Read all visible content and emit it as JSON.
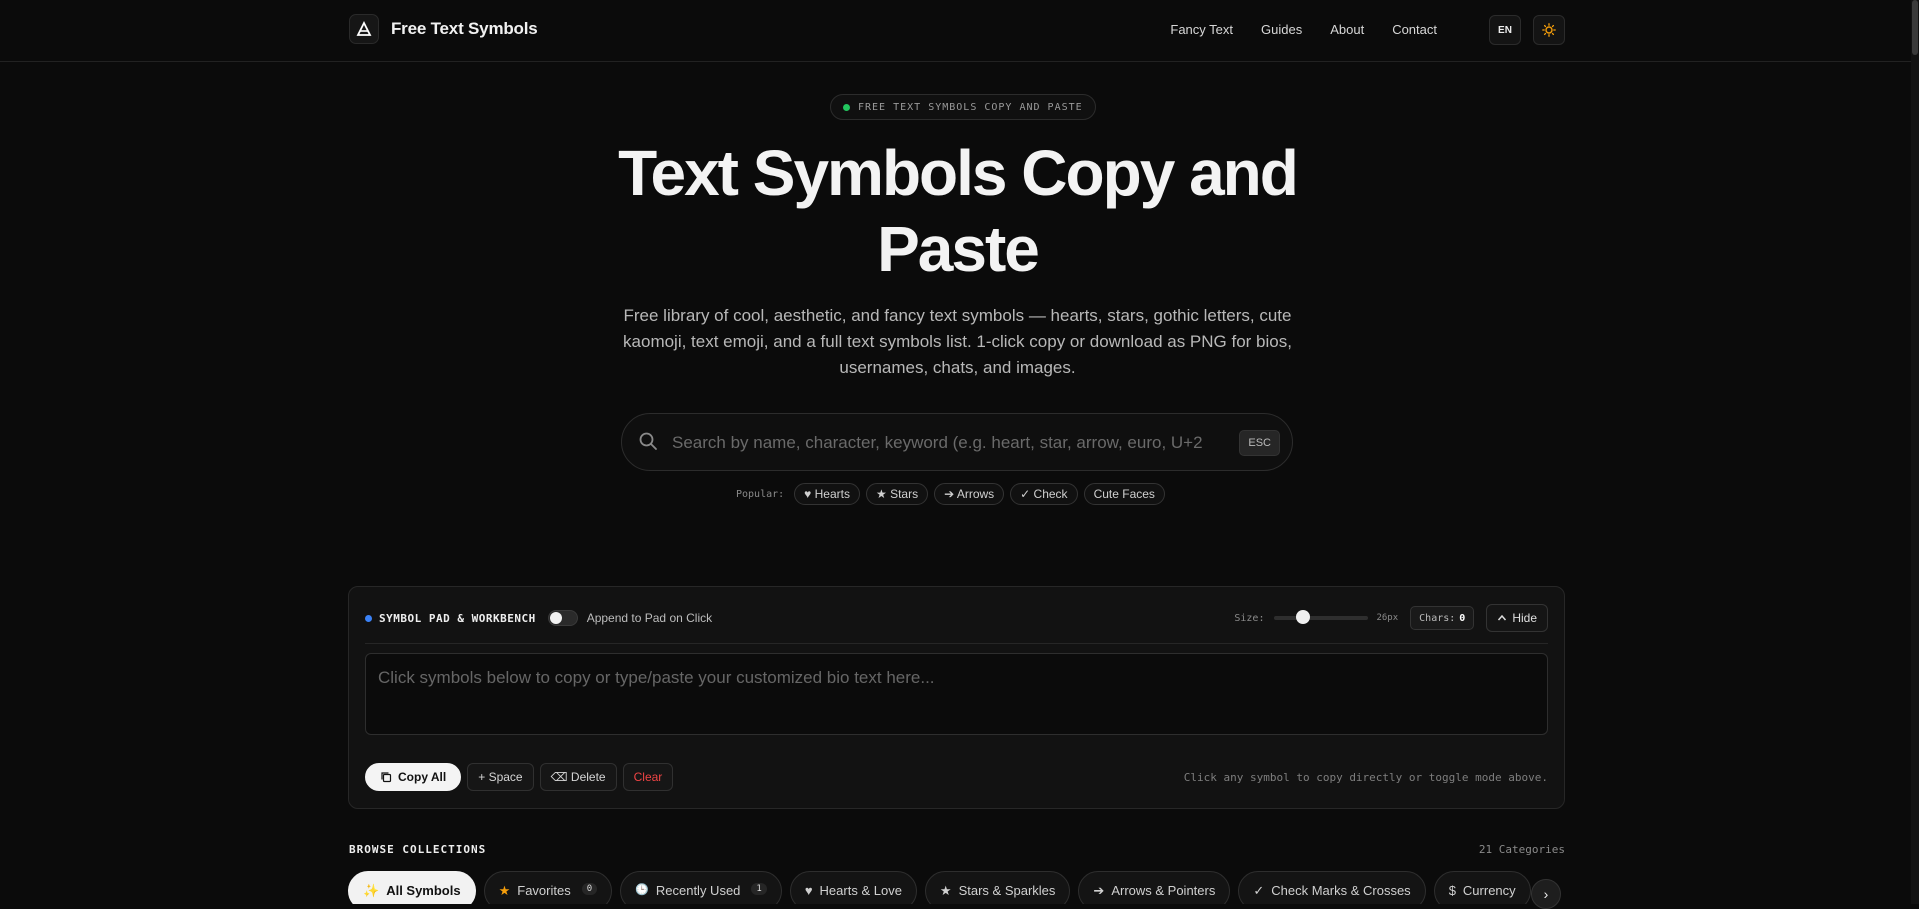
{
  "header": {
    "brand": "Free Text Symbols",
    "nav": [
      "Fancy Text",
      "Guides",
      "About",
      "Contact"
    ],
    "lang": "EN",
    "icons": {
      "logo": "triangle-logo-icon",
      "theme": "sun-icon"
    }
  },
  "hero": {
    "badge": "FREE TEXT SYMBOLS COPY AND PASTE",
    "title": "Text Symbols Copy and Paste",
    "subtitle": "Free library of cool, aesthetic, and fancy text symbols — hearts, stars, gothic letters, cute kaomoji, text emoji, and a full text symbols list. 1-click copy or download as PNG for bios, usernames, chats, and images."
  },
  "search": {
    "placeholder": "Search by name, character, keyword (e.g. heart, star, arrow, euro, U+2764)",
    "esc": "ESC",
    "popular_label": "Popular:",
    "popular": [
      "♥ Hearts",
      "★ Stars",
      "➔ Arrows",
      "✓ Check",
      "Cute Faces"
    ]
  },
  "pad": {
    "title": "SYMBOL PAD & WORKBENCH",
    "toggle_label": "Append to Pad on Click",
    "toggle_on": false,
    "size_label": "Size:",
    "size_value": "26px",
    "chars_label": "Chars:",
    "chars_value": "0",
    "hide": "Hide",
    "placeholder": "Click symbols below to copy or type/paste your customized bio text here...",
    "actions": {
      "copy_all": "Copy All",
      "space": "+ Space",
      "delete": "⌫ Delete",
      "clear": "Clear"
    },
    "hint": "Click any symbol to copy directly or toggle mode above."
  },
  "collections": {
    "title": "BROWSE COLLECTIONS",
    "count": "21 Categories",
    "tabs": [
      {
        "icon": "✨",
        "label": "All Symbols",
        "active": true
      },
      {
        "icon": "★",
        "label": "Favorites",
        "count": "0"
      },
      {
        "icon": "🕒",
        "label": "Recently Used",
        "count": "1"
      },
      {
        "icon": "♥",
        "label": "Hearts & Love"
      },
      {
        "icon": "★",
        "label": "Stars & Sparkles"
      },
      {
        "icon": "➔",
        "label": "Arrows & Pointers"
      },
      {
        "icon": "✓",
        "label": "Check Marks & Crosses"
      },
      {
        "icon": "$",
        "label": "Currency"
      }
    ],
    "next": "›"
  },
  "colors": {
    "accent_green": "#22c55e",
    "accent_blue": "#3b82f6",
    "danger": "#ef4444",
    "star": "#f59e0b"
  }
}
